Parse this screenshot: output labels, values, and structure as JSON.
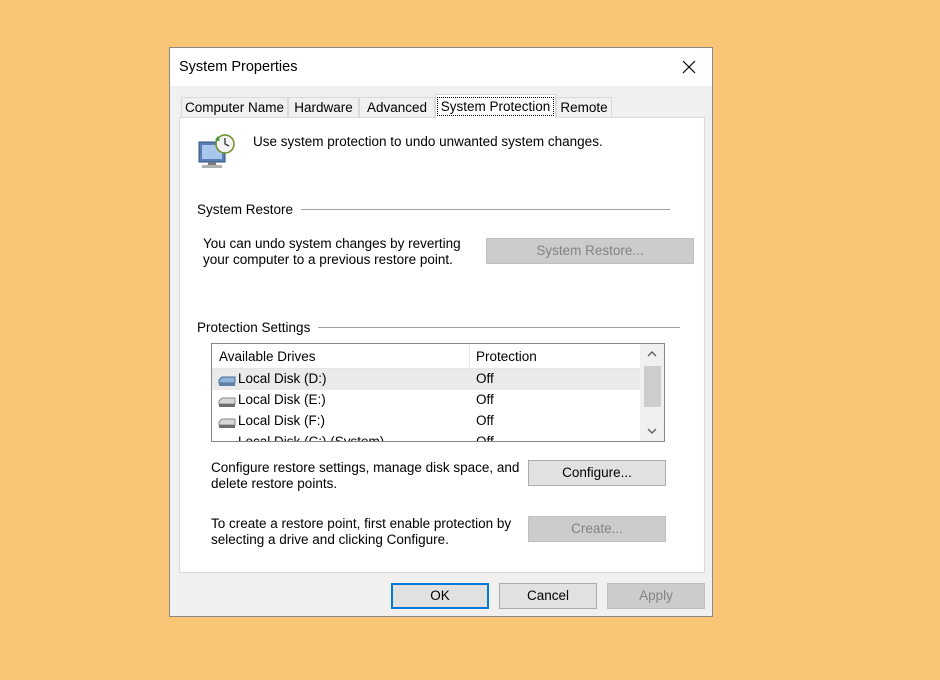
{
  "window": {
    "title": "System Properties"
  },
  "tabs": [
    {
      "label": "Computer Name"
    },
    {
      "label": "Hardware"
    },
    {
      "label": "Advanced"
    },
    {
      "label": "System Protection",
      "active": true
    },
    {
      "label": "Remote"
    }
  ],
  "header": {
    "description": "Use system protection to undo unwanted system changes."
  },
  "system_restore": {
    "group_label": "System Restore",
    "text_line1": "You can undo system changes by reverting",
    "text_line2": "your computer to a previous restore point.",
    "button_label": "System Restore..."
  },
  "protection_settings": {
    "group_label": "Protection Settings",
    "columns": [
      "Available Drives",
      "Protection"
    ],
    "drives": [
      {
        "name": "Local Disk (D:)",
        "protection": "Off",
        "selected": true
      },
      {
        "name": "Local Disk (E:)",
        "protection": "Off"
      },
      {
        "name": "Local Disk (F:)",
        "protection": "Off"
      },
      {
        "name": "Local Disk (C:) (System)",
        "protection": "Off"
      }
    ],
    "configure_line1": "Configure restore settings, manage disk space, and",
    "configure_line2": "delete restore points.",
    "configure_button": "Configure...",
    "create_line1": "To create a restore point, first enable protection by",
    "create_line2": "selecting a drive and clicking Configure.",
    "create_button": "Create..."
  },
  "footer": {
    "ok": "OK",
    "cancel": "Cancel",
    "apply": "Apply"
  },
  "colors": {
    "background": "#F9C576",
    "dialog": "#F0F0F0",
    "accent": "#0078D7"
  },
  "icons": [
    "close-icon",
    "system-protection-icon",
    "drive-icon",
    "windows-drive-icon",
    "chevron-up-icon",
    "chevron-down-icon"
  ]
}
